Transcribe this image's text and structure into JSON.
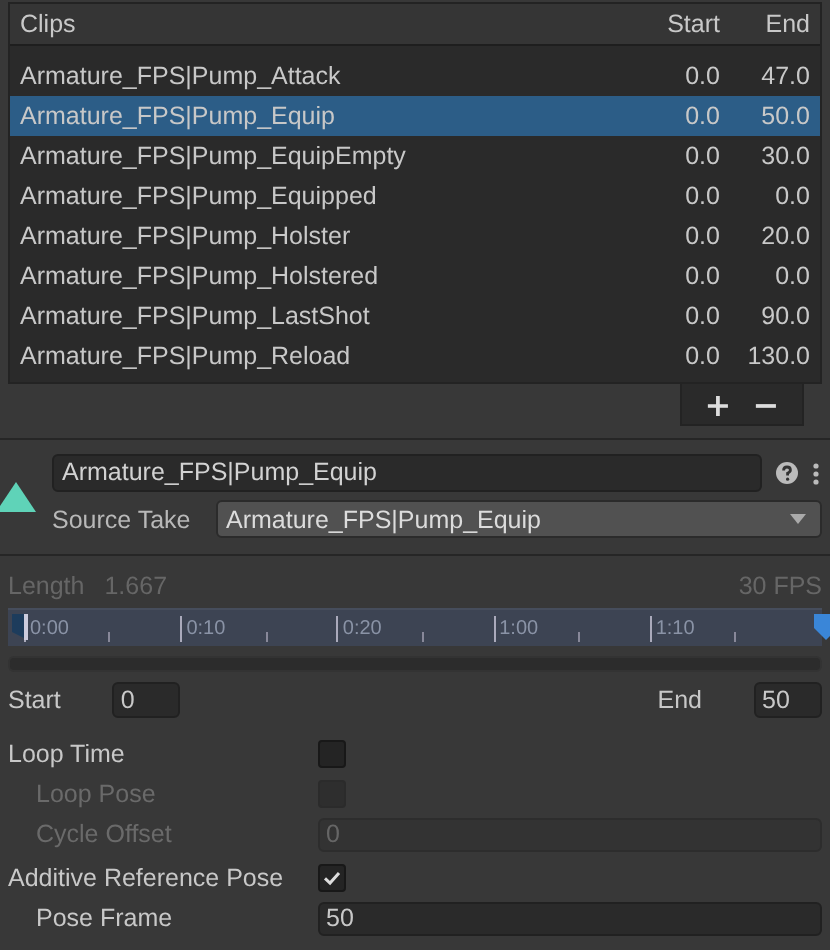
{
  "clips": {
    "header": {
      "name": "Clips",
      "start": "Start",
      "end": "End"
    },
    "rows": [
      {
        "name": "Armature_FPS|Pump_Attack",
        "start": "0.0",
        "end": "47.0",
        "selected": false
      },
      {
        "name": "Armature_FPS|Pump_Equip",
        "start": "0.0",
        "end": "50.0",
        "selected": true
      },
      {
        "name": "Armature_FPS|Pump_EquipEmpty",
        "start": "0.0",
        "end": "30.0",
        "selected": false
      },
      {
        "name": "Armature_FPS|Pump_Equipped",
        "start": "0.0",
        "end": "0.0",
        "selected": false
      },
      {
        "name": "Armature_FPS|Pump_Holster",
        "start": "0.0",
        "end": "20.0",
        "selected": false
      },
      {
        "name": "Armature_FPS|Pump_Holstered",
        "start": "0.0",
        "end": "0.0",
        "selected": false
      },
      {
        "name": "Armature_FPS|Pump_LastShot",
        "start": "0.0",
        "end": "90.0",
        "selected": false
      },
      {
        "name": "Armature_FPS|Pump_Reload",
        "start": "0.0",
        "end": "130.0",
        "selected": false
      }
    ],
    "buttons": [
      "+",
      "−"
    ]
  },
  "clip_name": "Armature_FPS|Pump_Equip",
  "source_take": {
    "label": "Source Take",
    "value": "Armature_FPS|Pump_Equip"
  },
  "length": {
    "label": "Length",
    "value": "1.667",
    "fps": "30 FPS"
  },
  "timeline": {
    "ticks": [
      "0:00",
      "0:10",
      "0:20",
      "1:00",
      "1:10"
    ],
    "markers": [
      {
        "kind": "start",
        "level": 0
      },
      {
        "kind": "end",
        "level": 1
      }
    ]
  },
  "range": {
    "start_label": "Start",
    "start": "0",
    "end_label": "End",
    "end": "50"
  },
  "settings": [
    {
      "kind": "checkbox",
      "label": "Loop Time",
      "checked": false,
      "disabled": false,
      "children": [
        {
          "kind": "checkbox",
          "label": "Loop Pose",
          "checked": false,
          "disabled": true
        },
        {
          "kind": "field",
          "label": "Cycle Offset",
          "value": "0",
          "disabled": true
        }
      ]
    },
    {
      "kind": "checkbox",
      "label": "Additive Reference Pose",
      "checked": true,
      "disabled": false,
      "children": [
        {
          "kind": "field",
          "label": "Pose Frame",
          "value": "50",
          "disabled": false
        }
      ]
    }
  ]
}
